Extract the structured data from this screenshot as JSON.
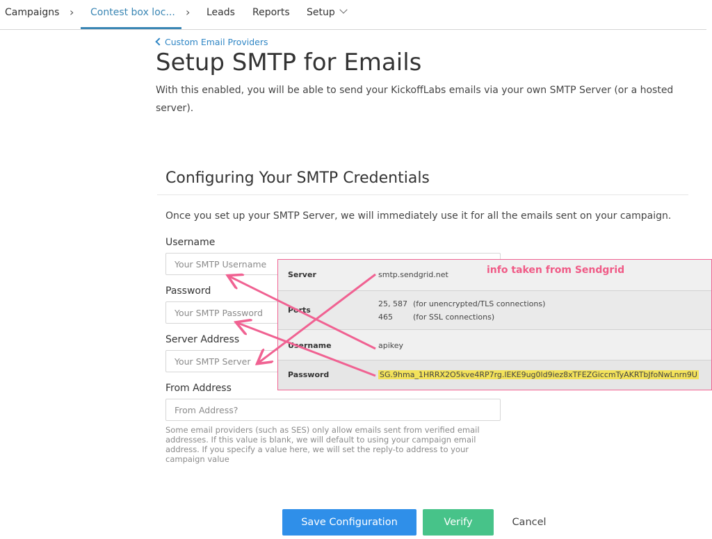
{
  "nav": {
    "items": [
      "Campaigns",
      "Contest box loc...",
      "Leads",
      "Reports",
      "Setup"
    ]
  },
  "back_link": "Custom Email Providers",
  "title": "Setup SMTP for Emails",
  "intro": "With this enabled, you will be able to send your KickoffLabs emails via your own SMTP Server (or a hosted server).",
  "section": {
    "title": "Configuring Your SMTP Credentials",
    "description": "Once you set up your SMTP Server, we will immediately use it for all the emails sent on your campaign."
  },
  "form": {
    "username": {
      "label": "Username",
      "placeholder": "Your SMTP Username"
    },
    "password": {
      "label": "Password",
      "placeholder": "Your SMTP Password"
    },
    "server": {
      "label": "Server Address",
      "placeholder": "Your SMTP Server"
    },
    "from": {
      "label": "From Address",
      "placeholder": "From Address?"
    },
    "help": "Some email providers (such as SES) only allow emails sent from verified email addresses. If this value is blank, we will default to using your campaign email address. If you specify a value here, we will set the reply-to address to your campaign value"
  },
  "buttons": {
    "save": "Save Configuration",
    "verify": "Verify",
    "cancel": "Cancel"
  },
  "overlay": {
    "caption": "info taken from Sendgrid",
    "server_key": "Server",
    "server_val": "smtp.sendgrid.net",
    "ports_key": "Ports",
    "ports_val_1": "25, 587",
    "ports_note_1": "(for unencrypted/TLS connections)",
    "ports_val_2": "465",
    "ports_note_2": "(for SSL connections)",
    "username_key": "Username",
    "username_val": "apikey",
    "password_key": "Password",
    "password_val": "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"
  },
  "colors": {
    "accent": "#3a86b4",
    "save": "#2f8fe9",
    "verify": "#47c389",
    "annotation": "#f06292"
  }
}
